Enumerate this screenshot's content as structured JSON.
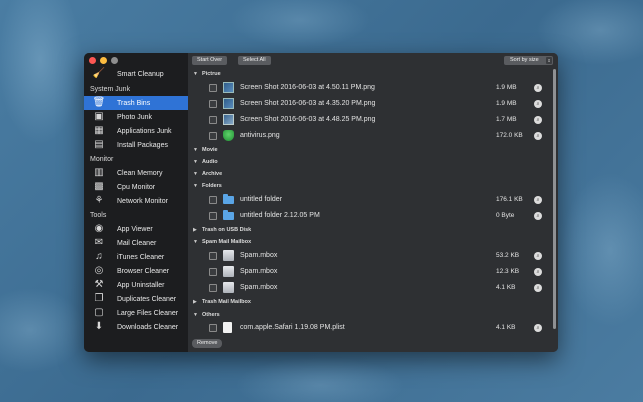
{
  "sidebar": {
    "top_item": {
      "label": "Smart Cleanup",
      "icon": "broom-icon"
    },
    "sections": [
      "System Junk",
      "Monitor",
      "Tools"
    ],
    "system_junk": [
      {
        "label": "Trash Bins",
        "icon": "trash-icon",
        "active": true
      },
      {
        "label": "Photo Junk",
        "icon": "photo-icon"
      },
      {
        "label": "Applications Junk",
        "icon": "apps-grid-icon"
      },
      {
        "label": "Install Packages",
        "icon": "package-icon"
      }
    ],
    "monitor": [
      {
        "label": "Clean Memory",
        "icon": "memory-chip-icon"
      },
      {
        "label": "Cpu Monitor",
        "icon": "cpu-icon"
      },
      {
        "label": "Network Monitor",
        "icon": "network-icon"
      }
    ],
    "tools": [
      {
        "label": "App Viewer",
        "icon": "eye-icon"
      },
      {
        "label": "Mail Cleaner",
        "icon": "mail-icon"
      },
      {
        "label": "iTunes Cleaner",
        "icon": "music-icon"
      },
      {
        "label": "Browser Cleaner",
        "icon": "globe-icon"
      },
      {
        "label": "App Uninstaller",
        "icon": "wrench-icon"
      },
      {
        "label": "Duplicates Cleaner",
        "icon": "duplicate-icon"
      },
      {
        "label": "Large Files Cleaner",
        "icon": "large-file-icon"
      },
      {
        "label": "Downloads Cleaner",
        "icon": "download-icon"
      }
    ]
  },
  "toolbar": {
    "start_over": "Start Over",
    "select_all": "Select All",
    "sort": "Sort by size"
  },
  "groups": {
    "pictrue": "Pictrue",
    "movie": "Movie",
    "audio": "Audio",
    "archive": "Archive",
    "folders": "Folders",
    "trash_usb": "Trash on USB Disk",
    "spam_mail": "Spam Mail Mailbox",
    "trash_mail": "Trash Mail Mailbox",
    "others": "Others"
  },
  "files": {
    "pictrue": [
      {
        "name": "Screen Shot 2016-06-03 at 4.50.11 PM.png",
        "size": "1.9 MB"
      },
      {
        "name": "Screen Shot 2016-06-03 at 4.35.20 PM.png",
        "size": "1.9 MB"
      },
      {
        "name": "Screen Shot 2016-06-03 at 4.48.25 PM.png",
        "size": "1.7 MB"
      },
      {
        "name": "antivirus.png",
        "size": "172.0 KB"
      }
    ],
    "folders": [
      {
        "name": "untitled folder",
        "size": "176.1 KB"
      },
      {
        "name": "untitled folder 2.12.05 PM",
        "size": "0 Byte"
      }
    ],
    "spam_mail": [
      {
        "name": "Spam.mbox",
        "size": "53.2 KB"
      },
      {
        "name": "Spam.mbox",
        "size": "12.3 KB"
      },
      {
        "name": "Spam.mbox",
        "size": "4.1 KB"
      }
    ],
    "others": [
      {
        "name": "com.apple.Safari 1.19.08 PM.plist",
        "size": "4.1 KB"
      }
    ]
  },
  "footer": {
    "remove": "Remove"
  }
}
